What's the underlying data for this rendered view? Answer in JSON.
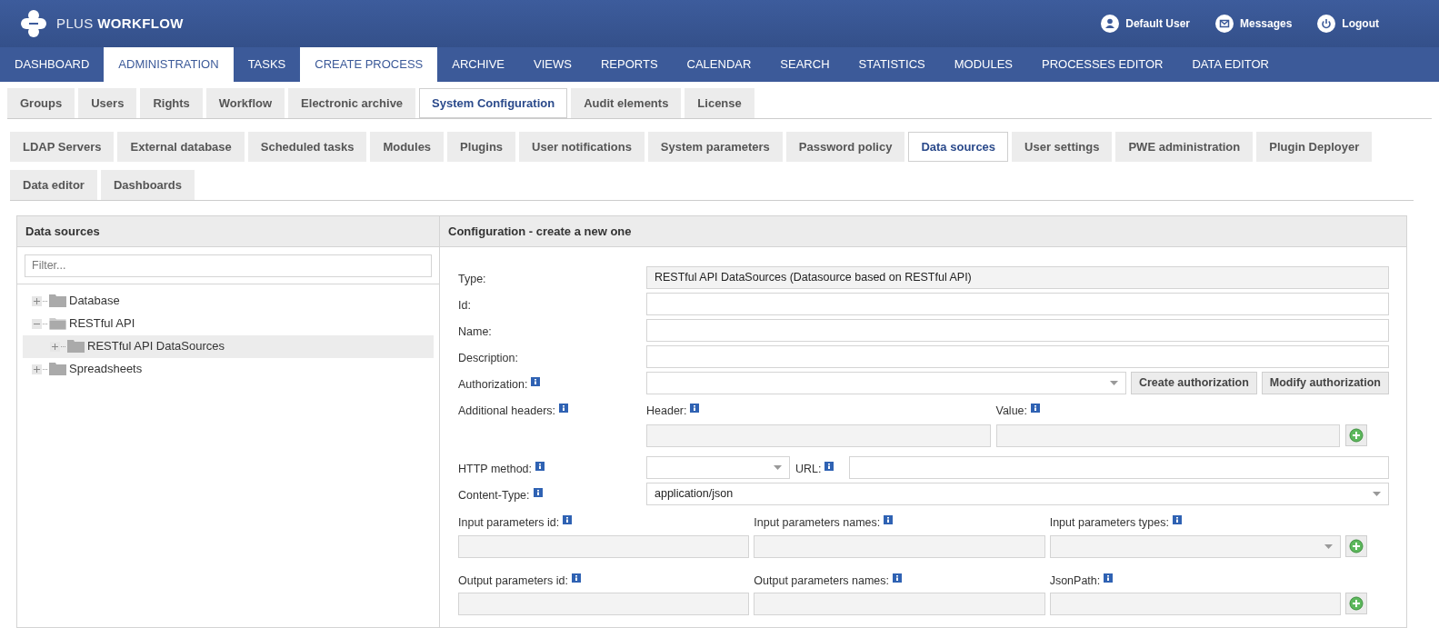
{
  "header": {
    "logo_light": "PLUS",
    "logo_bold": "WORKFLOW",
    "links": [
      {
        "kind": "user",
        "label": "Default User"
      },
      {
        "kind": "messages",
        "label": "Messages"
      },
      {
        "kind": "logout",
        "label": "Logout"
      }
    ]
  },
  "nav": [
    {
      "label": "DASHBOARD",
      "selected": false
    },
    {
      "label": "ADMINISTRATION",
      "selected": true
    },
    {
      "label": "TASKS",
      "selected": false
    },
    {
      "label": "CREATE PROCESS",
      "selected": true
    },
    {
      "label": "ARCHIVE",
      "selected": false
    },
    {
      "label": "VIEWS",
      "selected": false
    },
    {
      "label": "REPORTS",
      "selected": false
    },
    {
      "label": "CALENDAR",
      "selected": false
    },
    {
      "label": "SEARCH",
      "selected": false
    },
    {
      "label": "STATISTICS",
      "selected": false
    },
    {
      "label": "MODULES",
      "selected": false
    },
    {
      "label": "PROCESSES EDITOR",
      "selected": false
    },
    {
      "label": "DATA EDITOR",
      "selected": false
    }
  ],
  "tabs": [
    {
      "label": "Groups",
      "selected": false
    },
    {
      "label": "Users",
      "selected": false
    },
    {
      "label": "Rights",
      "selected": false
    },
    {
      "label": "Workflow",
      "selected": false
    },
    {
      "label": "Electronic archive",
      "selected": false
    },
    {
      "label": "System Configuration",
      "selected": true
    },
    {
      "label": "Audit elements",
      "selected": false
    },
    {
      "label": "License",
      "selected": false
    }
  ],
  "subtabs": [
    {
      "label": "LDAP Servers",
      "selected": false
    },
    {
      "label": "External database",
      "selected": false
    },
    {
      "label": "Scheduled tasks",
      "selected": false
    },
    {
      "label": "Modules",
      "selected": false
    },
    {
      "label": "Plugins",
      "selected": false
    },
    {
      "label": "User notifications",
      "selected": false
    },
    {
      "label": "System parameters",
      "selected": false
    },
    {
      "label": "Password policy",
      "selected": false
    },
    {
      "label": "Data sources",
      "selected": true
    },
    {
      "label": "User settings",
      "selected": false
    },
    {
      "label": "PWE administration",
      "selected": false
    },
    {
      "label": "Plugin Deployer",
      "selected": false
    },
    {
      "label": "Data editor",
      "selected": false
    },
    {
      "label": "Dashboards",
      "selected": false
    }
  ],
  "left_panel": {
    "title": "Data sources",
    "filter_placeholder": "Filter...",
    "tree": [
      {
        "label": "Database",
        "expanded": false,
        "selected": false
      },
      {
        "label": "RESTful API",
        "expanded": true,
        "selected": false,
        "children": [
          {
            "label": "RESTful API DataSources",
            "expanded": false,
            "selected": true
          }
        ]
      },
      {
        "label": "Spreadsheets",
        "expanded": false,
        "selected": false
      }
    ]
  },
  "right_panel": {
    "title": "Configuration - create a new one",
    "rows": [
      {
        "kind": "readonly",
        "label": "Type:",
        "value": "RESTful API DataSources (Datasource based on RESTful API)"
      },
      {
        "kind": "text",
        "label": "Id:"
      },
      {
        "kind": "text",
        "label": "Name:"
      },
      {
        "kind": "text",
        "label": "Description:"
      },
      {
        "kind": "select_buttons",
        "label": "Authorization:",
        "info": true,
        "buttons": [
          "Create authorization",
          "Modify authorization"
        ]
      },
      {
        "kind": "pair",
        "label": "Additional headers:",
        "info": true,
        "columns": [
          {
            "label": "Header:",
            "info": true,
            "disabled": true
          },
          {
            "label": "Value:",
            "info": true,
            "disabled": true
          }
        ]
      },
      {
        "kind": "method_url",
        "label": "HTTP method:",
        "info": true,
        "url_label": "URL:",
        "url_info": true
      },
      {
        "kind": "select",
        "label": "Content-Type:",
        "info": true,
        "value": "application/json"
      }
    ],
    "param_groups": [
      {
        "columns": [
          {
            "kind": "text",
            "label": "Input parameters id:",
            "info": true,
            "disabled": true
          },
          {
            "kind": "text",
            "label": "Input parameters names:",
            "info": true,
            "disabled": true
          },
          {
            "kind": "select",
            "label": "Input parameters types:",
            "info": true,
            "disabled": true
          }
        ]
      },
      {
        "columns": [
          {
            "kind": "text",
            "label": "Output parameters id:",
            "info": true,
            "disabled": true
          },
          {
            "kind": "text",
            "label": "Output parameters names:",
            "info": true,
            "disabled": true
          },
          {
            "kind": "text",
            "label": "JsonPath:",
            "info": true,
            "disabled": true
          }
        ]
      }
    ]
  }
}
